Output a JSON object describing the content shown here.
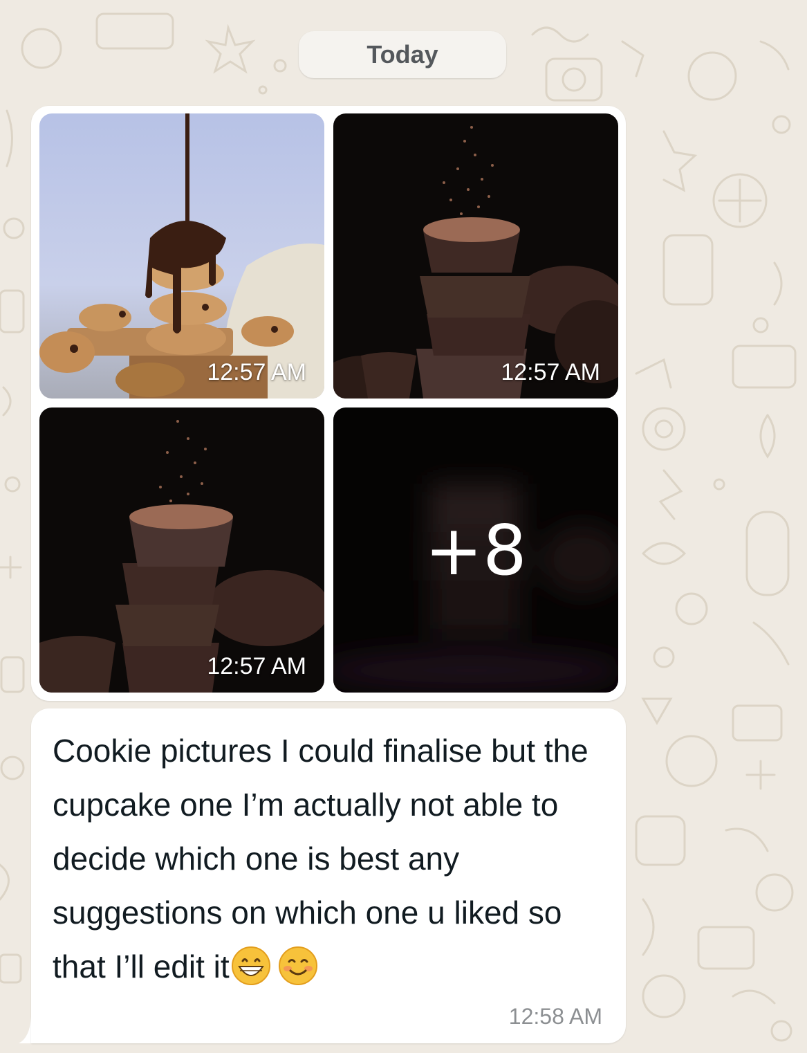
{
  "chat": {
    "date_separator": "Today",
    "media_message": {
      "items": [
        {
          "description": "stacked-chocolate-chip-cookies-photo",
          "time": "12:57 AM"
        },
        {
          "description": "stacked-chocolate-cupcakes-photo",
          "time": "12:57 AM"
        },
        {
          "description": "stacked-chocolate-cupcakes-photo",
          "time": "12:57 AM"
        },
        {
          "description": "more-photos-thumbnail",
          "more_count": "+8"
        }
      ]
    },
    "text_message": {
      "text": "Cookie pictures I could finalise but the cupcake one I’m actually not able to decide which one is best any suggestions on which one u liked so that I’ll edit it",
      "emojis": [
        "grinning-face-emoji",
        "smiling-face-emoji"
      ],
      "time": "12:58 AM"
    }
  },
  "colors": {
    "wallpaper": "#efeae2",
    "bubble": "#ffffff",
    "text": "#111b21",
    "timestamp": "#8c8f92"
  }
}
